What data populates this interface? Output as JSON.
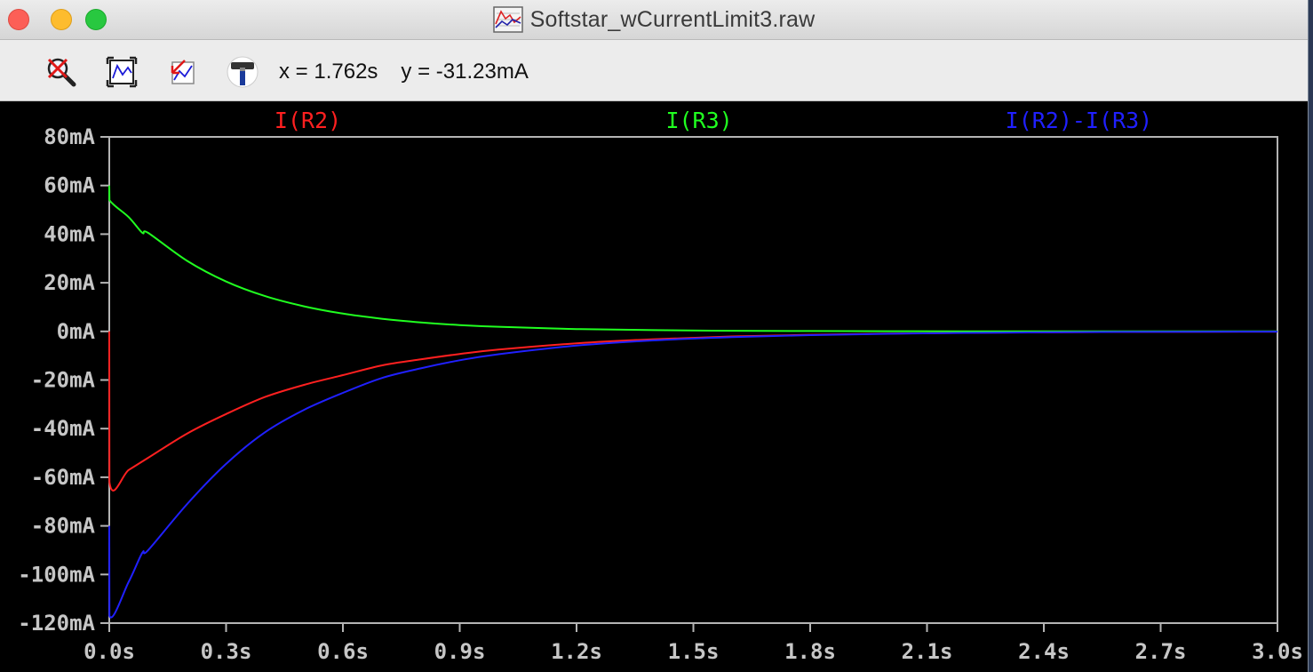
{
  "window": {
    "title": "Softstar_wCurrentLimit3.raw",
    "title_icon": "waveform-file-icon"
  },
  "toolbar": {
    "buttons": [
      {
        "name": "zoom-cancel-button",
        "icon": "magnifier-cross-icon"
      },
      {
        "name": "zoom-full-extents-button",
        "icon": "fit-extents-icon"
      },
      {
        "name": "zoom-back-button",
        "icon": "zoom-back-icon"
      },
      {
        "name": "autorange-button",
        "icon": "hammer-icon"
      }
    ],
    "cursor_x": "x = 1.762s",
    "cursor_y": "y = -31.23mA"
  },
  "colors": {
    "background": "#000000",
    "axis": "#b4b4b4",
    "R2": "#ff2020",
    "R3": "#20ff20",
    "diff": "#2020ff"
  },
  "chart_data": {
    "type": "line",
    "xlim": [
      0,
      3.0
    ],
    "ylim": [
      -120,
      80
    ],
    "x_ticks": [
      "0.0s",
      "0.3s",
      "0.6s",
      "0.9s",
      "1.2s",
      "1.5s",
      "1.8s",
      "2.1s",
      "2.4s",
      "2.7s",
      "3.0s"
    ],
    "y_ticks": [
      "80mA",
      "60mA",
      "40mA",
      "20mA",
      "0mA",
      "-20mA",
      "-40mA",
      "-60mA",
      "-80mA",
      "-100mA",
      "-120mA"
    ],
    "y_tick_values": [
      80,
      60,
      40,
      20,
      0,
      -20,
      -40,
      -60,
      -80,
      -100,
      -120
    ],
    "x_tick_values": [
      0,
      0.3,
      0.6,
      0.9,
      1.2,
      1.5,
      1.8,
      2.1,
      2.4,
      2.7,
      3.0
    ],
    "grid": false,
    "legend_position": "top",
    "series": [
      {
        "name": "I(R2)",
        "color": "#ff2020",
        "x": [
          0,
          0.0005,
          0.05,
          0.1,
          0.2,
          0.3,
          0.4,
          0.5,
          0.6,
          0.7,
          0.8,
          0.9,
          1.0,
          1.2,
          1.4,
          1.6,
          1.8,
          2.0,
          2.2,
          2.5,
          2.8,
          3.0
        ],
        "y": [
          0,
          -62,
          -57,
          -52,
          -42,
          -34,
          -27,
          -22,
          -18,
          -14,
          -11.5,
          -9.3,
          -7.5,
          -4.9,
          -3.2,
          -2.1,
          -1.4,
          -0.9,
          -0.6,
          -0.3,
          -0.15,
          -0.1
        ]
      },
      {
        "name": "I(R3)",
        "color": "#20ff20",
        "x": [
          0,
          0.0005,
          0.05,
          0.085,
          0.1,
          0.2,
          0.3,
          0.4,
          0.5,
          0.6,
          0.7,
          0.8,
          0.9,
          1.0,
          1.2,
          1.4,
          1.6,
          1.8,
          2.0,
          2.2,
          2.5,
          2.8,
          3.0
        ],
        "y": [
          60,
          54,
          47,
          40.5,
          40.5,
          29,
          20.5,
          14.5,
          10.3,
          7.3,
          5.2,
          3.7,
          2.6,
          1.9,
          0.95,
          0.5,
          0.25,
          0.13,
          0.07,
          0.03,
          0.01,
          0.0,
          0.0
        ]
      },
      {
        "name": "I(R2)-I(R3)",
        "color": "#2020ff",
        "x": [
          0,
          0.0005,
          0.05,
          0.085,
          0.1,
          0.2,
          0.3,
          0.4,
          0.5,
          0.6,
          0.7,
          0.8,
          0.9,
          1.0,
          1.2,
          1.4,
          1.6,
          1.8,
          2.0,
          2.2,
          2.5,
          2.8,
          3.0
        ],
        "y": [
          -80,
          -117,
          -103,
          -91,
          -90,
          -71,
          -54.5,
          -41.5,
          -32.3,
          -25.3,
          -19.2,
          -15.2,
          -11.9,
          -9.4,
          -5.85,
          -3.7,
          -2.35,
          -1.53,
          -0.97,
          -0.63,
          -0.31,
          -0.15,
          -0.1
        ]
      }
    ]
  }
}
